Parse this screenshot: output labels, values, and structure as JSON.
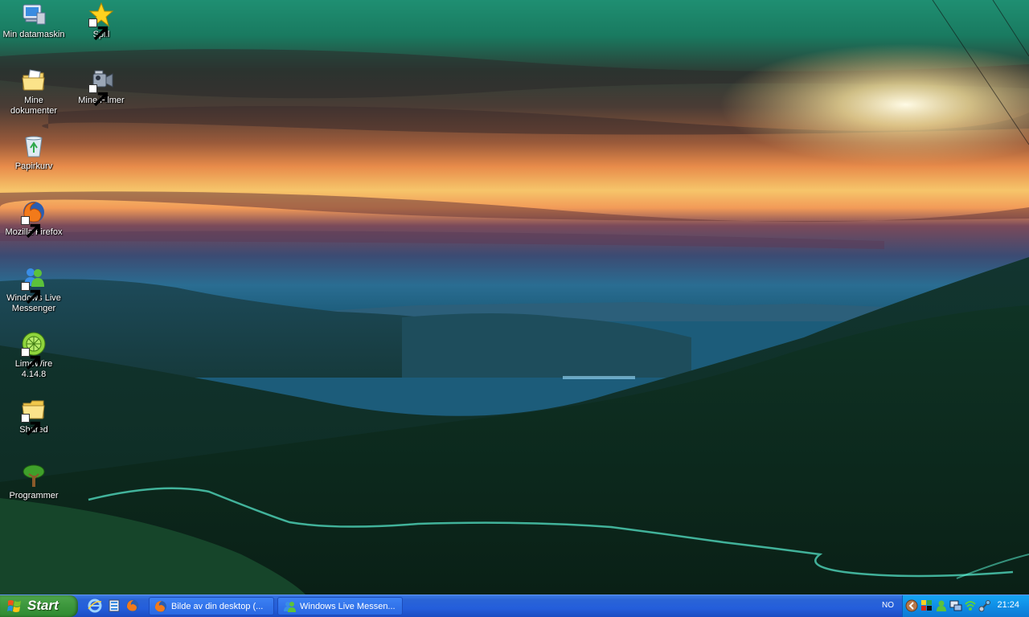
{
  "desktop": {
    "icons": [
      {
        "label": "Min datamaskin"
      },
      {
        "label": "Spill"
      },
      {
        "label": "Mine dokumenter"
      },
      {
        "label": "Mine Filmer"
      },
      {
        "label": "Papirkurv"
      },
      {
        "label": "Mozilla Firefox"
      },
      {
        "label": "Windows Live Messenger"
      },
      {
        "label": "LimeWire 4.14.8"
      },
      {
        "label": "Shared"
      },
      {
        "label": "Programmer"
      }
    ]
  },
  "taskbar": {
    "start_label": "Start",
    "quick_launch": [
      {
        "icon": "internet-explorer-icon"
      },
      {
        "icon": "show-desktop-icon"
      },
      {
        "icon": "firefox-icon"
      }
    ],
    "windows": [
      {
        "label": "Bilde av din desktop (...",
        "icon": "firefox-icon"
      },
      {
        "label": "Windows Live Messen...",
        "icon": "messenger-icon"
      }
    ],
    "language": "NO",
    "clock": "21:24"
  },
  "colors": {
    "taskbar_blue": "#245edb",
    "start_green": "#3c963c",
    "tray_blue": "#0f8ee6"
  }
}
